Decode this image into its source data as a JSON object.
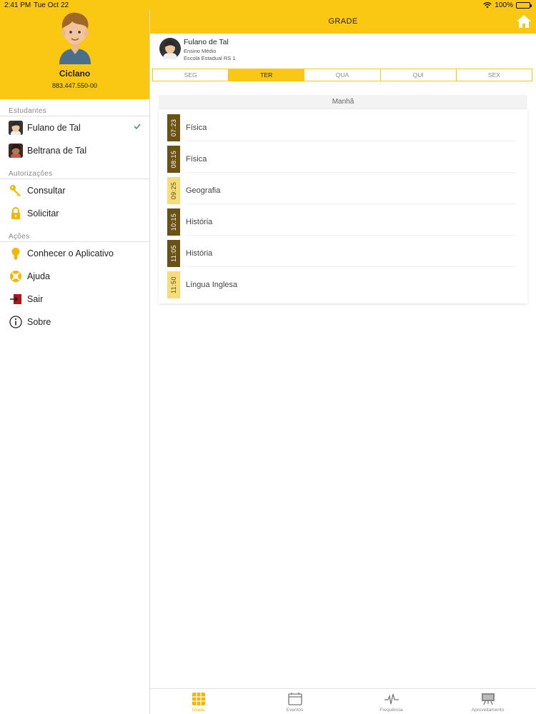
{
  "status_bar": {
    "time": "2:41 PM",
    "date": "Tue Oct 22",
    "battery": "100%"
  },
  "profile": {
    "name": "Ciclano",
    "cpf": "883.447.550-00"
  },
  "sidebar": {
    "students_title": "Estudantes",
    "students": [
      {
        "label": "Fulano de Tal",
        "selected": true
      },
      {
        "label": "Beltrana de Tal",
        "selected": false
      }
    ],
    "auth_title": "Autorizações",
    "auth_items": [
      {
        "label": "Consultar",
        "icon": "key-icon"
      },
      {
        "label": "Solicitar",
        "icon": "lock-icon"
      }
    ],
    "actions_title": "Ações",
    "action_items": [
      {
        "label": "Conhecer o Aplicativo",
        "icon": "lightbulb-icon"
      },
      {
        "label": "Ajuda",
        "icon": "lifebuoy-icon"
      },
      {
        "label": "Sair",
        "icon": "exit-icon"
      },
      {
        "label": "Sobre",
        "icon": "info-icon"
      }
    ]
  },
  "header": {
    "title": "GRADE"
  },
  "student": {
    "name": "Fulano de Tal",
    "level": "Ensino Médio",
    "school": "Escola Estadual RS 1"
  },
  "days": [
    "SEG",
    "TER",
    "QUA",
    "QUI",
    "SEX"
  ],
  "active_day": "TER",
  "schedule": {
    "section": "Manhã",
    "items": [
      {
        "time": "07:23",
        "subject": "Física",
        "style": "dark"
      },
      {
        "time": "08:15",
        "subject": "Física",
        "style": "dark"
      },
      {
        "time": "09:25",
        "subject": "Geografia",
        "style": "light"
      },
      {
        "time": "10:15",
        "subject": "História",
        "style": "dark"
      },
      {
        "time": "11:05",
        "subject": "História",
        "style": "dark"
      },
      {
        "time": "11:50",
        "subject": "Língua Inglesa",
        "style": "light"
      }
    ]
  },
  "bottom_tabs": [
    {
      "label": "Grade",
      "active": true
    },
    {
      "label": "Eventos",
      "active": false
    },
    {
      "label": "Frequência",
      "active": false
    },
    {
      "label": "Aproveitamento",
      "active": false
    }
  ],
  "colors": {
    "accent": "#fac812",
    "time_dark": "#6b5214",
    "time_light": "#f7dd7a",
    "check": "#2f8f4e"
  }
}
